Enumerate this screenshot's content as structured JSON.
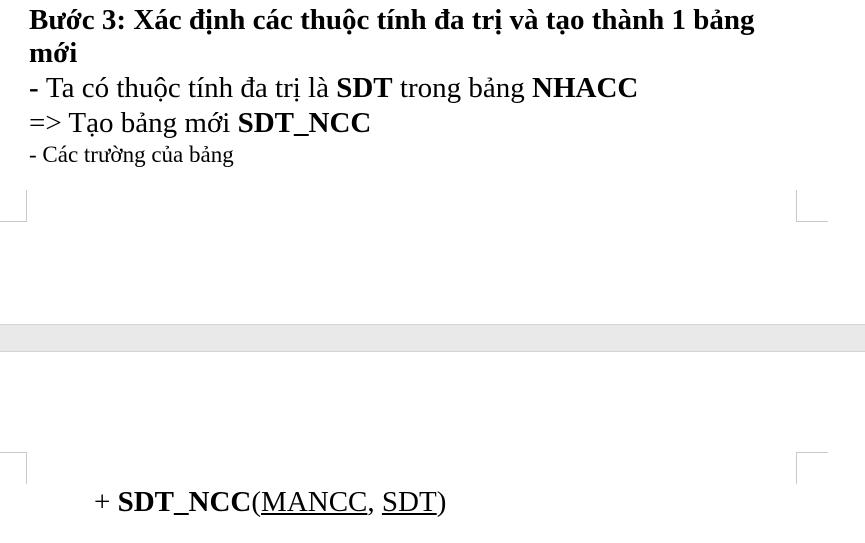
{
  "document": {
    "heading": "Bước 3: Xác định các thuộc tính đa trị và tạo thành 1 bảng mới",
    "line1": {
      "prefix": "- ",
      "text": "Ta có thuộc tính đa trị là ",
      "attr": "SDT",
      "middle": " trong bảng ",
      "table": "NHACC"
    },
    "line2": {
      "text": "=> Tạo bảng mới ",
      "table": "SDT_NCC"
    },
    "line3": "- Các trường của bảng",
    "schema": {
      "prefix": "+ ",
      "table": "SDT_NCC",
      "open": "(",
      "field1": "MANCC",
      "sep": ", ",
      "field2": "SDT",
      "close": ")"
    }
  }
}
